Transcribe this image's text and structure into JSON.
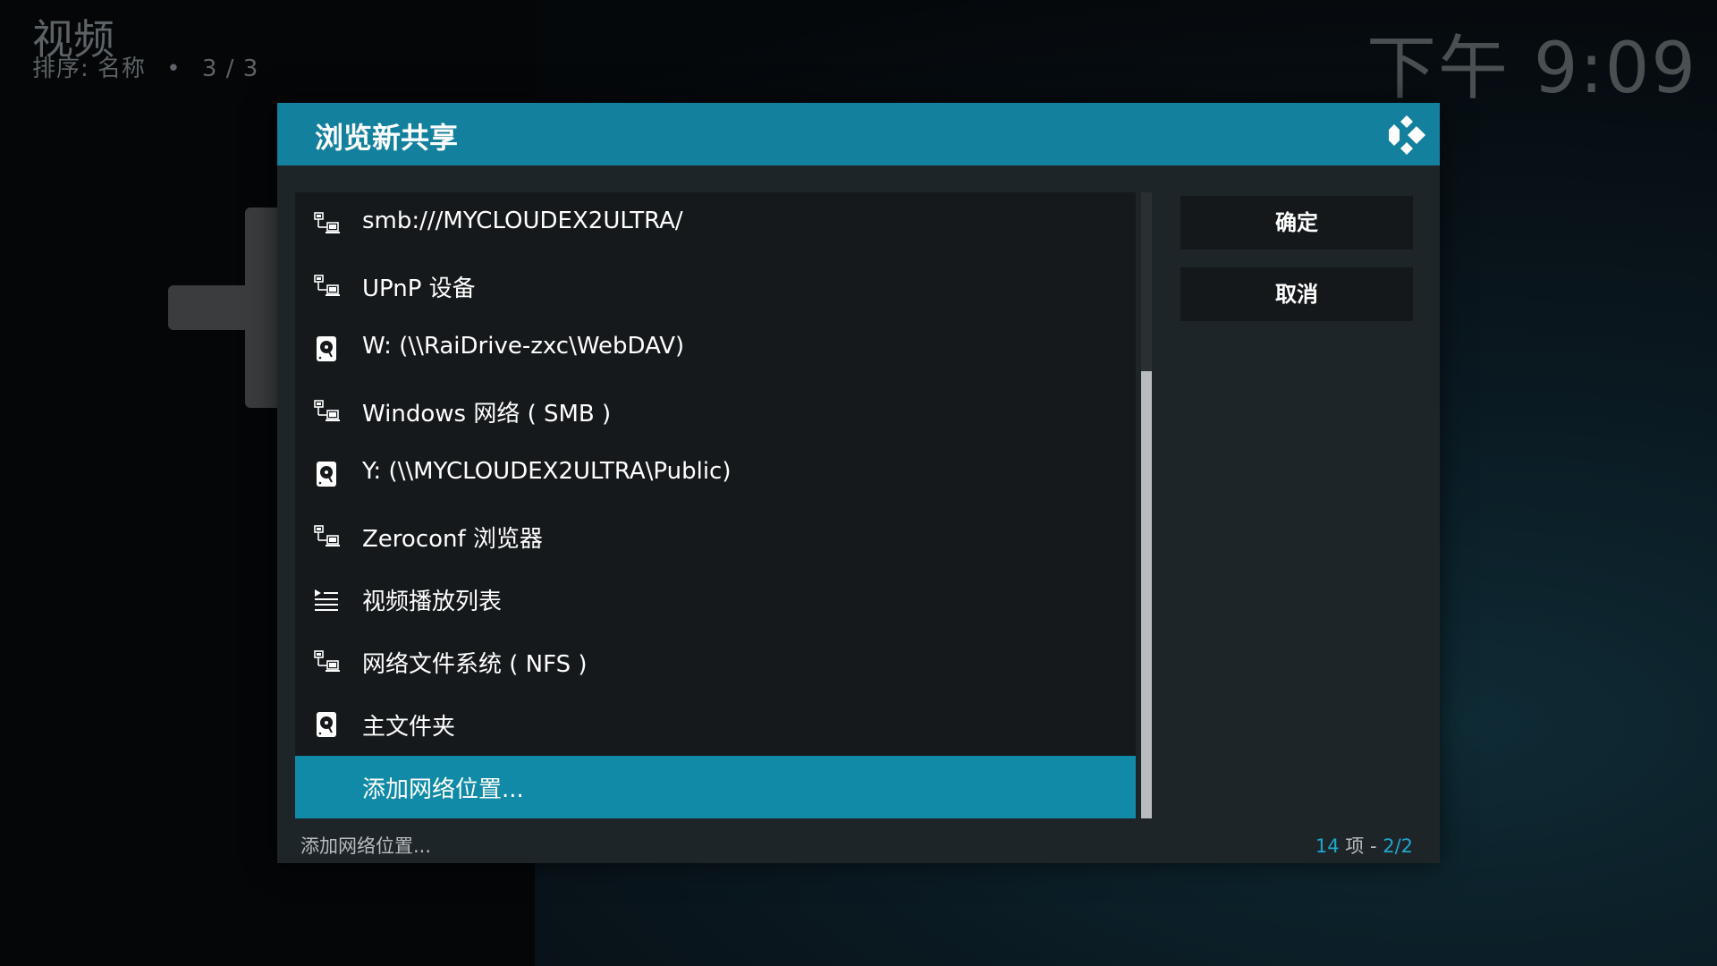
{
  "header": {
    "title": "视频",
    "sort_label": "排序: 名称",
    "bullet": "•",
    "position": "3 / 3"
  },
  "clock": "下午 9:09",
  "dialog": {
    "title": "浏览新共享",
    "items": [
      {
        "label": "smb:///MYCLOUDEX2ULTRA/",
        "icon": "network-icon"
      },
      {
        "label": "UPnP 设备",
        "icon": "network-icon"
      },
      {
        "label": "W: (\\\\RaiDrive-zxc\\WebDAV)",
        "icon": "hard-drive-icon"
      },
      {
        "label": "Windows 网络 ( SMB )",
        "icon": "network-icon"
      },
      {
        "label": "Y: (\\\\MYCLOUDEX2ULTRA\\Public)",
        "icon": "hard-drive-icon"
      },
      {
        "label": "Zeroconf 浏览器",
        "icon": "network-icon"
      },
      {
        "label": "视频播放列表",
        "icon": "playlist-icon"
      },
      {
        "label": "网络文件系统 ( NFS )",
        "icon": "network-icon"
      },
      {
        "label": "主文件夹",
        "icon": "hard-drive-icon"
      },
      {
        "label": "添加网络位置...",
        "icon": "",
        "selected": true
      }
    ],
    "buttons": {
      "ok": "确定",
      "cancel": "取消"
    },
    "footer": {
      "selected_item": "添加网络位置...",
      "count": "14",
      "count_label": "项",
      "separator": "-",
      "page": "2/2"
    }
  },
  "colors": {
    "accent": "#13809d",
    "selection": "#108aa6",
    "count_text": "#1ea7cf"
  }
}
